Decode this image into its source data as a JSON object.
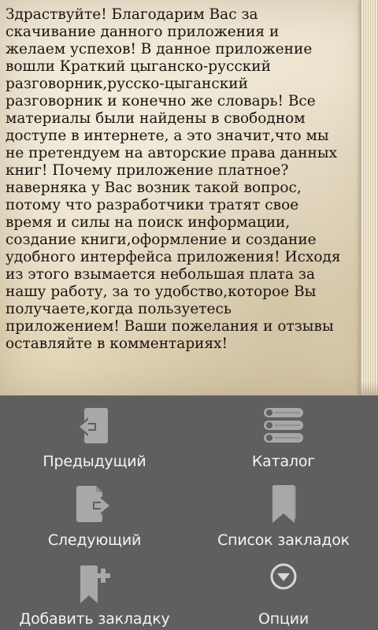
{
  "book": {
    "text": "Здраствуйте! Благодарим Вас за\nскачивание данного приложения и\nжелаем успехов! В данное приложение\nвошли Краткий цыганско-русский\nразговорник,русско-цыганский\nразговорник  и конечно же словарь! Все\nматериалы были найдены в свободном\nдоступе в интернете, а это значит,что мы\nне претендуем на авторские права данных\nкниг! Почему приложение платное?\nнаверняка у Вас возник такой вопрос,\nпотому что разработчики тратят свое\nвремя и силы на поиск информации,\nсоздание книги,оформление и создание\nудобного интерфейса приложения! Исходя\nиз этого взымается небольшая плата за\nнашу работу, за то удобство,которое Вы\nполучаете,когда пользуетесь\nприложением! Ваши пожелания и отзывы\nоставляйте в комментариях!"
  },
  "menu": {
    "items": [
      {
        "label": "Предыдущий",
        "icon": "previous-page-icon"
      },
      {
        "label": "Каталог",
        "icon": "catalog-list-icon"
      },
      {
        "label": "Следующий",
        "icon": "next-page-icon"
      },
      {
        "label": "Список закладок",
        "icon": "bookmark-list-icon"
      },
      {
        "label": "Добавить закладку",
        "icon": "add-bookmark-icon"
      },
      {
        "label": "Опции",
        "icon": "options-chevron-icon"
      }
    ],
    "colors": {
      "background": "#5f5f5f",
      "icon": "#a8a8a8",
      "label": "#f4f4f4"
    }
  }
}
